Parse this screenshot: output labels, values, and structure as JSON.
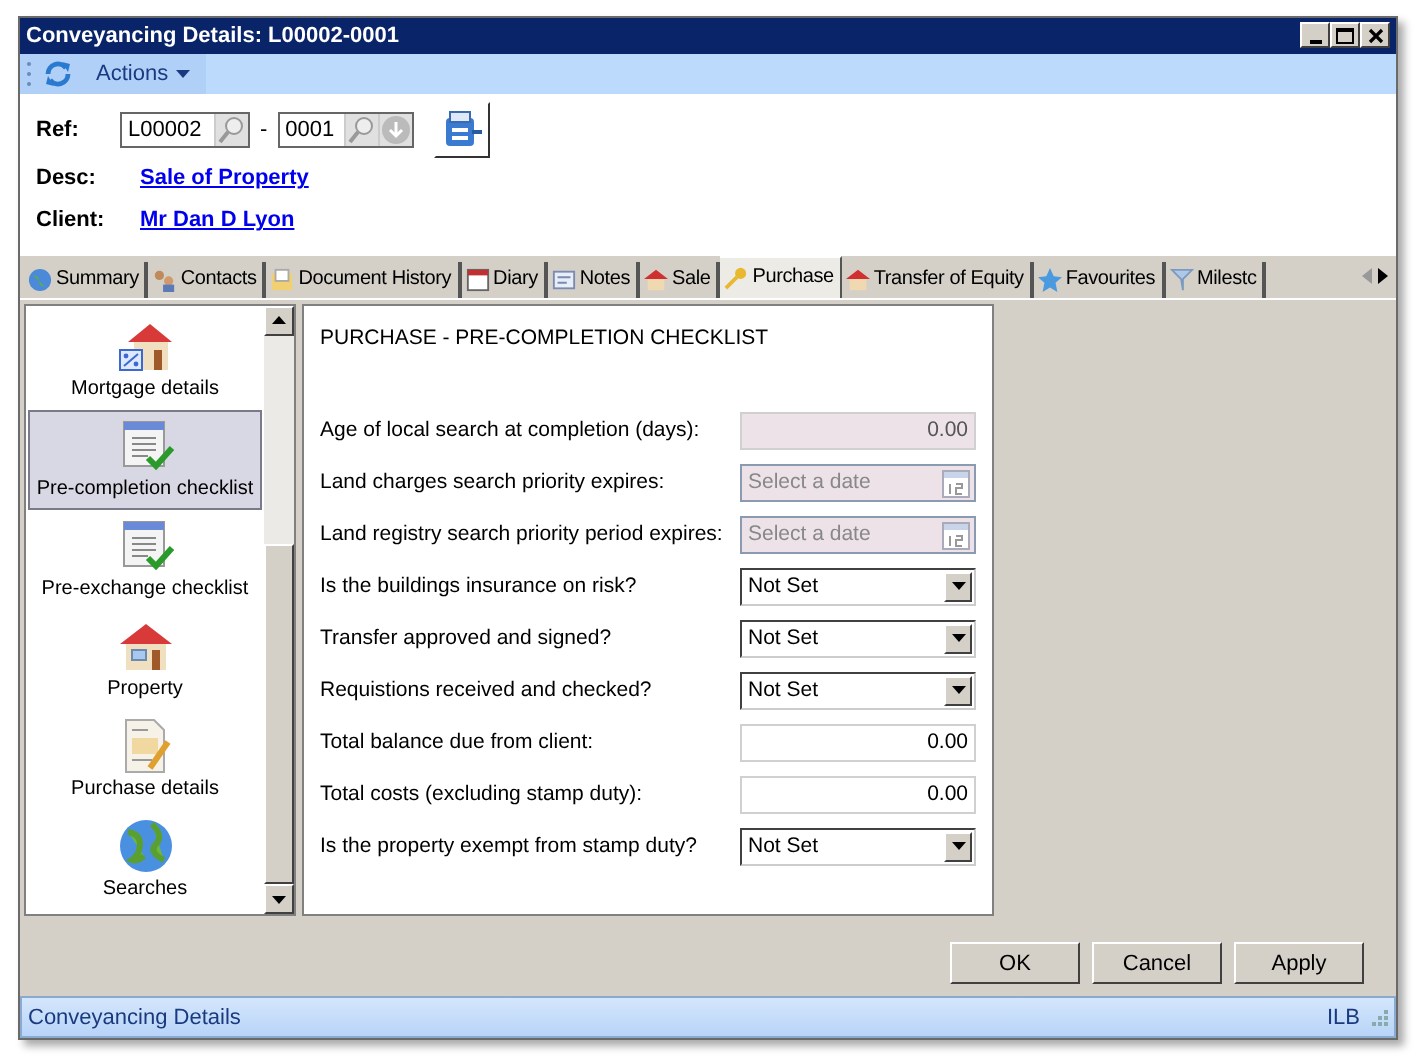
{
  "window": {
    "title": "Conveyancing Details: L00002-0001"
  },
  "toolbar": {
    "actions_label": "Actions"
  },
  "header": {
    "ref_label": "Ref:",
    "ref_value": "L00002",
    "ref_separator": "-",
    "ref_suffix": "0001",
    "desc_label": "Desc:",
    "desc_link": "Sale of Property",
    "client_label": "Client:",
    "client_link": "Mr Dan D Lyon"
  },
  "tabs": [
    {
      "label": "Summary",
      "selected": false
    },
    {
      "label": "Contacts",
      "selected": false
    },
    {
      "label": "Document History",
      "selected": false
    },
    {
      "label": "Diary",
      "selected": false
    },
    {
      "label": "Notes",
      "selected": false
    },
    {
      "label": "Sale",
      "selected": false
    },
    {
      "label": "Purchase",
      "selected": true
    },
    {
      "label": "Transfer of Equity",
      "selected": false
    },
    {
      "label": "Favourites",
      "selected": false
    },
    {
      "label": "Milestc",
      "selected": false
    }
  ],
  "sidebar": {
    "items": [
      {
        "label": "Mortgage details",
        "selected": false
      },
      {
        "label": "Pre-completion checklist",
        "selected": true
      },
      {
        "label": "Pre-exchange checklist",
        "selected": false
      },
      {
        "label": "Property",
        "selected": false
      },
      {
        "label": "Purchase details",
        "selected": false
      },
      {
        "label": "Searches",
        "selected": false
      }
    ]
  },
  "panel": {
    "title": "PURCHASE - PRE-COMPLETION CHECKLIST",
    "fields": [
      {
        "label": "Age of local search at completion (days):",
        "kind": "number",
        "value": "0.00",
        "disabled": true
      },
      {
        "label": "Land charges search priority expires:",
        "kind": "date",
        "placeholder": "Select a date",
        "disabled": true
      },
      {
        "label": "Land registry search priority period expires:",
        "kind": "date",
        "placeholder": "Select a date",
        "disabled": true
      },
      {
        "label": "Is the buildings insurance on risk?",
        "kind": "select",
        "value": "Not Set",
        "disabled": false
      },
      {
        "label": "Transfer approved and signed?",
        "kind": "select",
        "value": "Not Set",
        "disabled": false
      },
      {
        "label": "Requistions received and checked?",
        "kind": "select",
        "value": "Not Set",
        "disabled": false
      },
      {
        "label": "Total balance due from client:",
        "kind": "number",
        "value": "0.00",
        "disabled": false
      },
      {
        "label": "Total costs (excluding stamp duty):",
        "kind": "number",
        "value": "0.00",
        "disabled": false
      },
      {
        "label": "Is the property exempt from stamp duty?",
        "kind": "select",
        "value": "Not Set",
        "disabled": false
      }
    ]
  },
  "buttons": [
    "OK",
    "Cancel",
    "Apply"
  ],
  "status_bar": {
    "left": "Conveyancing Details",
    "right": "ILB"
  }
}
